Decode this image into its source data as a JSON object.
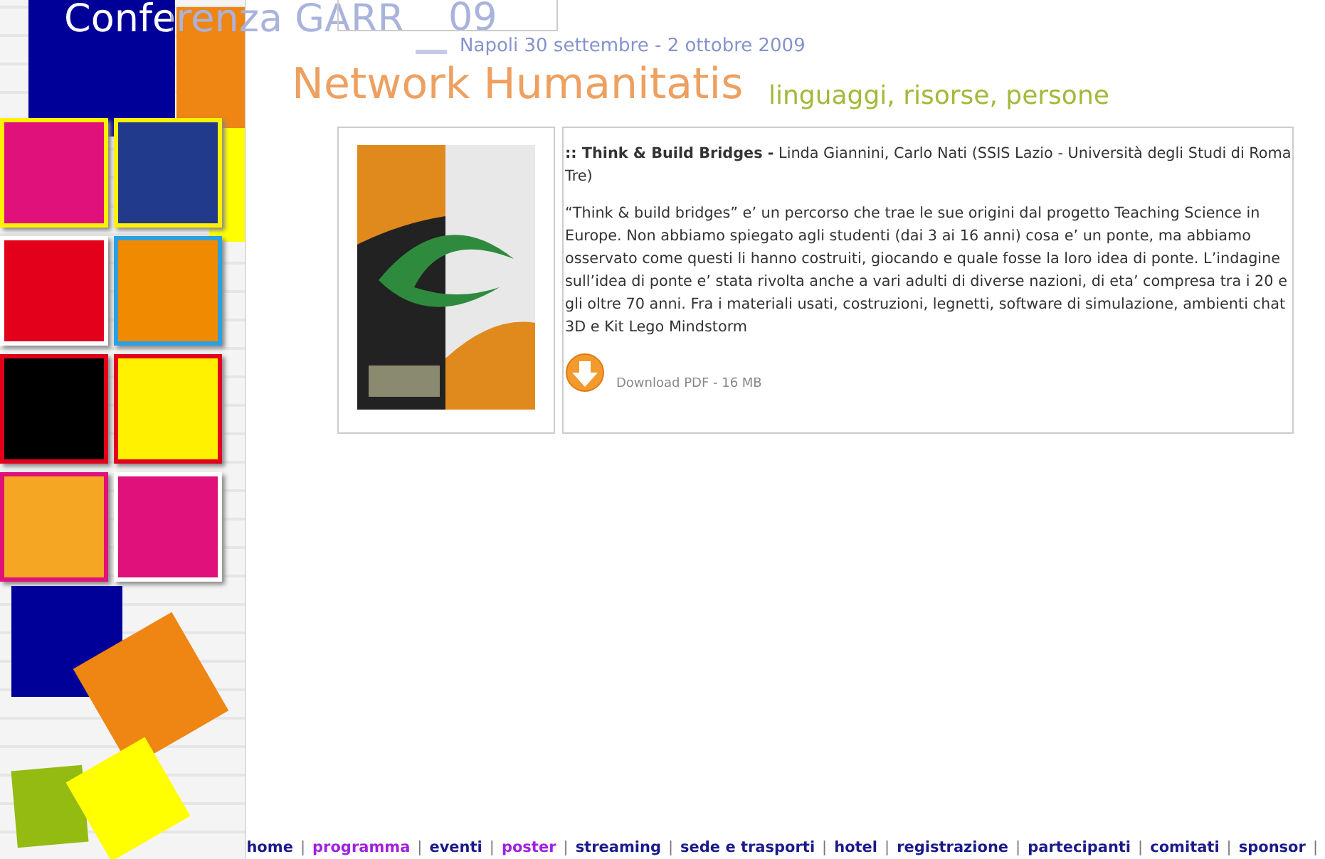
{
  "header": {
    "title": "Conferenza GARR",
    "edition": "09",
    "dates": "Napoli 30 settembre - 2 ottobre 2009",
    "theme": "Network Humanitatis",
    "subtitle": "linguaggi, risorse, persone"
  },
  "poster": {
    "title": ":: Think & Build Bridges -",
    "authors": "Linda Giannini, Carlo Nati (SSIS Lazio - Università degli Studi di Roma Tre)",
    "description": "“Think & build bridges” e’ un percorso che trae le sue origini dal progetto Teaching Science in Europe. Non abbiamo spiegato agli studenti (dai 3 ai 16 anni) cosa e’ un ponte, ma abbiamo osservato come questi li hanno costruiti, giocando e quale fosse la loro idea di ponte. L’indagine sull’idea di ponte e’ stata rivolta anche a vari adulti di diverse nazioni, di eta’ compresa tra i 20 e gli oltre 70 anni. Fra i materiali usati, costruzioni, legnetti, software di simulazione, ambienti chat 3D e Kit Lego Mindstorm",
    "download": "Download PDF - 16 MB"
  },
  "nav": [
    {
      "label": "home",
      "visited": false,
      "separator": "|"
    },
    {
      "label": "programma",
      "visited": true,
      "separator": "|"
    },
    {
      "label": "eventi",
      "visited": false,
      "separator": "|"
    },
    {
      "label": "poster",
      "visited": true,
      "separator": "|"
    },
    {
      "label": "streaming",
      "visited": false,
      "separator": "|"
    },
    {
      "label": "sede e trasporti",
      "visited": false,
      "separator": "|"
    },
    {
      "label": "hotel",
      "visited": false,
      "separator": "|"
    },
    {
      "label": "registrazione",
      "visited": false,
      "separator": "|"
    },
    {
      "label": "partecipanti",
      "visited": false,
      "separator": "|"
    },
    {
      "label": "comitati",
      "visited": false,
      "separator": "|"
    },
    {
      "label": "sponsor",
      "visited": false,
      "separator": "|"
    }
  ]
}
